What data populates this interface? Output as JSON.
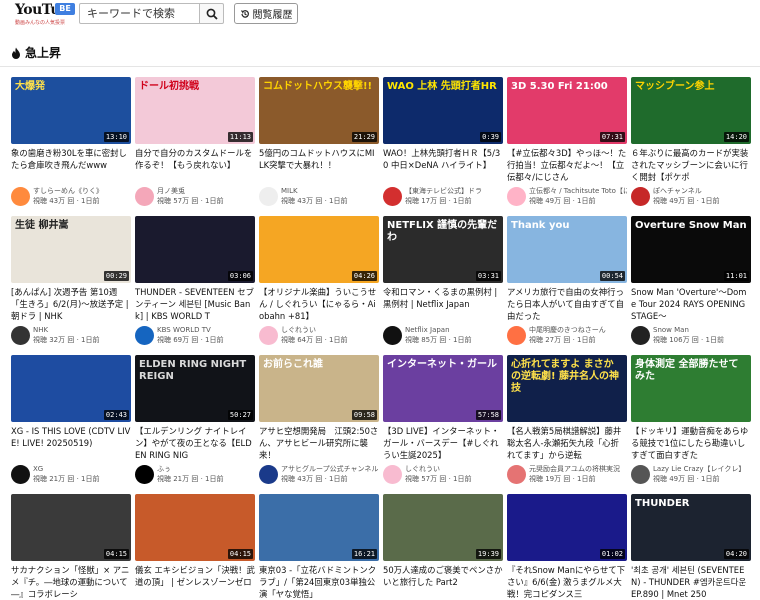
{
  "header": {
    "logo_text": "YouTu",
    "logo_badge": "BE",
    "logo_subtitle": "動画みんなの人気投票",
    "search_placeholder": "キーワードで検索",
    "history_label": "閲覧履歴"
  },
  "section": {
    "title": "急上昇"
  },
  "videos": [
    {
      "thumb_text": "大爆発",
      "thumb_color": "#1d4f9e",
      "text_color": "#ffe14a",
      "duration": "13:10",
      "title": "象の歯磨き粉30Lを車に密封したら倉庫吹き飛んだwww",
      "channel": "すしらーめん《りく》",
      "views": "視聴 43万 回",
      "age": "1日前",
      "avatar_color": "#ff8a3d"
    },
    {
      "thumb_text": "ドール初挑戦",
      "thumb_color": "#f3c9d8",
      "text_color": "#d0021b",
      "duration": "11:13",
      "title": "自分で自分のカスタムドールを作るぞ！【もう戻れない】",
      "channel": "月ノ美兎",
      "views": "視聴 57万 回",
      "age": "1日前",
      "avatar_color": "#f4a7b9"
    },
    {
      "thumb_text": "コムドットハウス襲撃!!",
      "thumb_color": "#8b5a2b",
      "text_color": "#ffd400",
      "duration": "21:29",
      "title": "5億円のコムドットハウスにMILK突撃で大暴れ！！",
      "channel": "MILK",
      "views": "視聴 43万 回",
      "age": "1日前",
      "avatar_color": "#eeeeee"
    },
    {
      "thumb_text": "WAO 上林 先頭打者HR",
      "thumb_color": "#0d2a6b",
      "text_color": "#ffe600",
      "duration": "0:39",
      "title": "WAO！上林先頭打者ＨＲ【5/30 中日×DeNA ハイライト】",
      "channel": "【東海テレビ公式】ドラ",
      "views": "視聴 17万 回",
      "age": "1日前",
      "avatar_color": "#d32f2f"
    },
    {
      "thumb_text": "3D 5.30 Fri 21:00",
      "thumb_color": "#e23b6a",
      "text_color": "#ffffff",
      "duration": "07:31",
      "title": "【#立伝都々3D】やっほ〜！た行拍当！立伝都々だよ〜！【立伝都々/にじさん",
      "channel": "立伝都々 / Tachitsute Toto【に",
      "views": "視聴 49万 回",
      "age": "1日前",
      "avatar_color": "#ffb3c7"
    },
    {
      "thumb_text": "マッシブーン参上",
      "thumb_color": "#1f6b2c",
      "text_color": "#ffd400",
      "duration": "14:20",
      "title": "６年ぶりに最高のカードが実装されたマッシブーンに会いに行く開封【ポケポ",
      "channel": "ぽへチャンネル",
      "views": "視聴 49万 回",
      "age": "1日前",
      "avatar_color": "#c62828"
    },
    {
      "thumb_text": "生徒 柳井嵩",
      "thumb_color": "#e9e4da",
      "text_color": "#222222",
      "duration": "00:29",
      "title": "[あんぱん] 次週予告 第10週「生きろ」6/2(月)～放送予定 | 朝ドラ | NHK",
      "channel": "NHK",
      "views": "視聴 32万 回",
      "age": "1日前",
      "avatar_color": "#333333"
    },
    {
      "thumb_text": "",
      "thumb_color": "#1a1a2e",
      "text_color": "#ffffff",
      "duration": "03:06",
      "title": "THUNDER - SEVENTEEN セブンティーン 세븐틴 [Music Bank] | KBS WORLD T",
      "channel": "KBS WORLD TV",
      "views": "視聴 69万 回",
      "age": "1日前",
      "avatar_color": "#1565c0"
    },
    {
      "thumb_text": "",
      "thumb_color": "#f5a623",
      "text_color": "#ffffff",
      "duration": "04:26",
      "title": "【オリジナル楽曲】ういこうせん / しぐれうい【にゃるら・Aiobahn +81】",
      "channel": "しぐれうい",
      "views": "視聴 64万 回",
      "age": "1日前",
      "avatar_color": "#f8bbd0"
    },
    {
      "thumb_text": "NETFLIX 謹慎の先輩だわ",
      "thumb_color": "#2b2b2b",
      "text_color": "#ffffff",
      "duration": "03:31",
      "title": "令和ロマン・くるまの黒例村 | 黒例村 | Netflix Japan",
      "channel": "Netflix Japan",
      "views": "視聴 85万 回",
      "age": "1日前",
      "avatar_color": "#111111"
    },
    {
      "thumb_text": "Thank you",
      "thumb_color": "#87b5e0",
      "text_color": "#ffffff",
      "duration": "00:54",
      "title": "アメリカ旅行で自由の女神行ったら日本人がいて自由すぎて自由だった",
      "channel": "中尾明慶のきつねさーん",
      "views": "視聴 27万 回",
      "age": "1日前",
      "avatar_color": "#ff7043"
    },
    {
      "thumb_text": "Overture Snow Man",
      "thumb_color": "#0a0a0a",
      "text_color": "#ffffff",
      "duration": "11:01",
      "title": "Snow Man 'Overture'〜Dome Tour 2024 RAYS OPENING STAGE〜",
      "channel": "Snow Man",
      "views": "視聴 106万 回",
      "age": "1日前",
      "avatar_color": "#222222"
    },
    {
      "thumb_text": "",
      "thumb_color": "#1e4ca1",
      "text_color": "#ffffff",
      "duration": "02:43",
      "title": "XG - IS THIS LOVE (CDTV LIVE! LIVE! 20250519)",
      "channel": "XG",
      "views": "視聴 21万 回",
      "age": "1日前",
      "avatar_color": "#111111"
    },
    {
      "thumb_text": "ELDEN RING NIGHTREIGN",
      "thumb_color": "#111318",
      "text_color": "#d9d9d9",
      "duration": "50:27",
      "title": "【エルデンリング ナイトレイン】やがて夜の王となる【ELDEN RING NIG",
      "channel": "ふぅ",
      "views": "視聴 21万 回",
      "age": "1日前",
      "avatar_color": "#000000"
    },
    {
      "thumb_text": "お前らこれ誰",
      "thumb_color": "#c9b48a",
      "text_color": "#ffffff",
      "duration": "09:58",
      "title": "アサヒ空想開発局　江頭2:50さん、アサヒビール研究所に襲来！",
      "channel": "アサヒグループ公式チャンネル",
      "views": "視聴 43万 回",
      "age": "1日前",
      "avatar_color": "#1a3a8a"
    },
    {
      "thumb_text": "インターネット・ガール",
      "thumb_color": "#6b3fa0",
      "text_color": "#ffffff",
      "duration": "57:58",
      "title": "【3D LIVE】インターネット・ガール・バースデー【#しぐれうい生誕2025】",
      "channel": "しぐれうい",
      "views": "視聴 57万 回",
      "age": "1日前",
      "avatar_color": "#f8bbd0"
    },
    {
      "thumb_text": "心折れてますよ まさかの逆転劇! 藤井名人の神技",
      "thumb_color": "#10204a",
      "text_color": "#ffe14a",
      "duration": "",
      "title": "【名人戦第5局棋譜解説】藤井聡太名人-永瀬拓矢九段「心折れてます」から逆転",
      "channel": "元奨励会員アユムの将棋実況",
      "views": "視聴 19万 回",
      "age": "1日前",
      "avatar_color": "#e57373"
    },
    {
      "thumb_text": "身体測定 全部勝たせてみた",
      "thumb_color": "#2e7d32",
      "text_color": "#ffffff",
      "duration": "",
      "title": "【ドッキリ】運動音痴をあらゆる競技で1位にしたら勘違いしすぎて面白すぎた",
      "channel": "Lazy Lie Crazy【レイクレ】",
      "views": "視聴 49万 回",
      "age": "1日前",
      "avatar_color": "#555555"
    },
    {
      "thumb_text": "",
      "thumb_color": "#3a3a3a",
      "text_color": "#ffffff",
      "duration": "04:15",
      "title": "サカナクション「怪獣」× アニメ『チ。―地球の運動について―』コラボレーシ",
      "channel": "",
      "views": "",
      "age": "",
      "avatar_color": "#cccccc"
    },
    {
      "thumb_text": "",
      "thumb_color": "#c75a2a",
      "text_color": "#ffffff",
      "duration": "04:15",
      "title": "儀玄 エキシビジョン「決戦！武道の頂」 | ゼンレスゾーンゼロ",
      "channel": "",
      "views": "",
      "age": "",
      "avatar_color": "#cccccc"
    },
    {
      "thumb_text": "",
      "thumb_color": "#3b6ea8",
      "text_color": "#ffffff",
      "duration": "16:21",
      "title": "東京03 -「立花バドミントンクラブ」/「第24回東京03単独公演「ヤな覚悟」",
      "channel": "",
      "views": "",
      "age": "",
      "avatar_color": "#cccccc"
    },
    {
      "thumb_text": "",
      "thumb_color": "#5a6b4a",
      "text_color": "#ffffff",
      "duration": "19:39",
      "title": "50万人達成のご褒美でペンさかいと旅行した Part2",
      "channel": "",
      "views": "",
      "age": "",
      "avatar_color": "#cccccc"
    },
    {
      "thumb_text": "",
      "thumb_color": "#1a1a8a",
      "text_color": "#ffe14a",
      "duration": "01:02",
      "title": "『それSnow Manにやらせて下さい』6/6(金) 激うまグルメ大戦！完コピダンス三",
      "channel": "",
      "views": "",
      "age": "",
      "avatar_color": "#cccccc"
    },
    {
      "thumb_text": "THUNDER",
      "thumb_color": "#1c2330",
      "text_color": "#ffffff",
      "duration": "04:20",
      "title": "'최초 공개' 세븐틴 (SEVENTEEN) - THUNDER #엠카운트다운 EP.890 | Mnet 250",
      "channel": "",
      "views": "",
      "age": "",
      "avatar_color": "#cccccc"
    }
  ]
}
